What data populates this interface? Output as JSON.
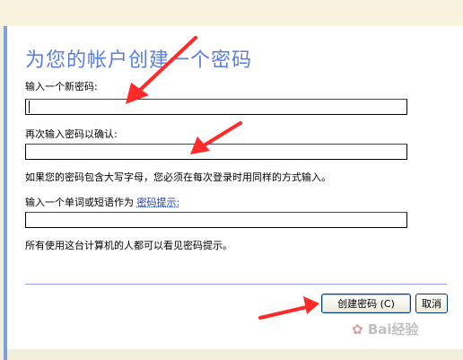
{
  "dialog": {
    "title": "为您的帐户创建一个密码",
    "new_password_label": "输入一个新密码:",
    "confirm_password_label": "再次输入密码以确认:",
    "case_note": "如果您的密码包含大写字母，您必须在每次登录时用同样的方式输入。",
    "hint_label": "输入一个单词或短语作为",
    "hint_link": "密码提示:",
    "visibility_note": "所有使用这台计算机的人都可以看见密码提示。",
    "new_password_value": "",
    "confirm_password_value": "",
    "hint_value": ""
  },
  "buttons": {
    "create_label": "创建密码 (C)",
    "cancel_label": "取消"
  },
  "watermark": {
    "text": "Bai经验"
  },
  "colors": {
    "title": "#5a7edc",
    "annotation_arrow": "#ff2a2a",
    "link": "#1b3fae",
    "button_border": "#003c74",
    "frame_blue": "#7f9fd9"
  },
  "icons": {
    "annotation": "red-arrow-icon"
  }
}
